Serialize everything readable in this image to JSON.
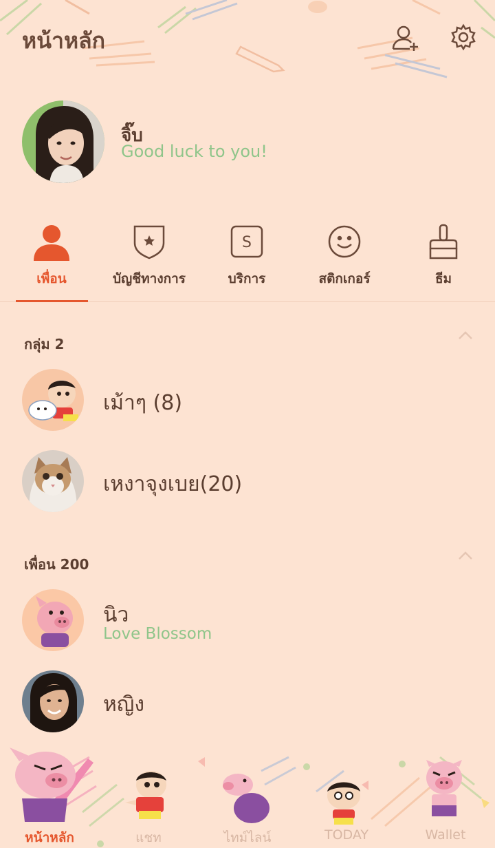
{
  "header": {
    "title": "หน้าหลัก",
    "add_friend_icon": "person-add-icon",
    "settings_icon": "gear-icon"
  },
  "profile": {
    "name": "จิ๊บ",
    "status": "Good luck to you!"
  },
  "tabs": [
    {
      "label": "เพื่อน",
      "icon": "person-icon",
      "active": true
    },
    {
      "label": "บัญชีทางการ",
      "icon": "shield-star-icon",
      "active": false
    },
    {
      "label": "บริการ",
      "icon": "service-s-icon",
      "active": false
    },
    {
      "label": "สติกเกอร์",
      "icon": "smiley-icon",
      "active": false
    },
    {
      "label": "ธีม",
      "icon": "brush-icon",
      "active": false
    }
  ],
  "groups": {
    "title": "กลุ่ม 2",
    "items": [
      {
        "name": "เม้าๆ (8)"
      },
      {
        "name": "เหงาจุงเบย(20)"
      }
    ]
  },
  "friends": {
    "title": "เพื่อน 200",
    "items": [
      {
        "name": "นิว",
        "status": "Love Blossom"
      },
      {
        "name": "หญิง",
        "status": ""
      }
    ]
  },
  "bottom_nav": [
    {
      "label": "หน้าหลัก",
      "active": true
    },
    {
      "label": "แชท",
      "active": false
    },
    {
      "label": "ไทม์ไลน์",
      "active": false
    },
    {
      "label": "TODAY",
      "active": false
    },
    {
      "label": "Wallet",
      "active": false
    }
  ],
  "colors": {
    "background": "#fde3d2",
    "accent": "#e5572e",
    "text": "#5b3e30",
    "status_green": "#8fc58a"
  }
}
